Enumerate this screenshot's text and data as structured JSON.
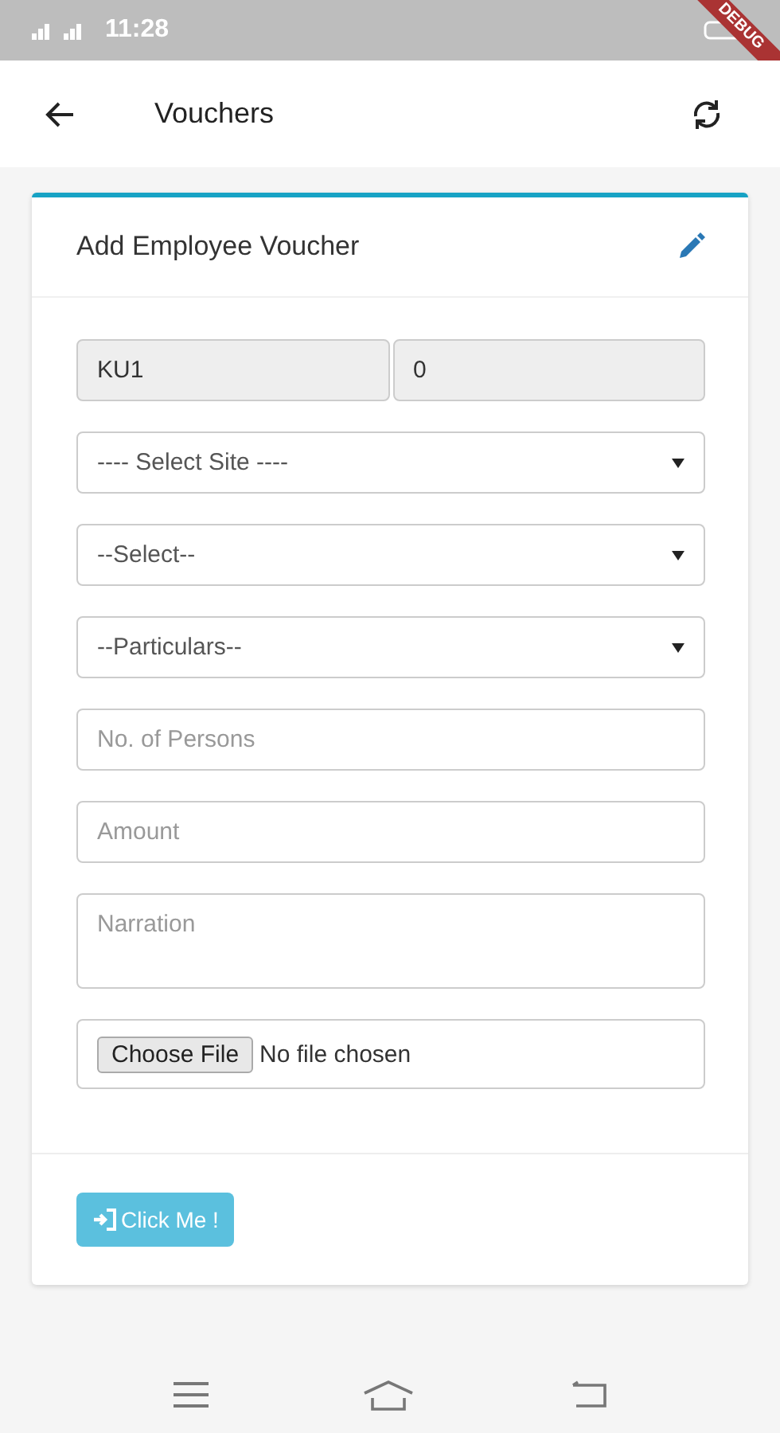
{
  "status_bar": {
    "time": "11:28"
  },
  "debug_banner": "DEBUG",
  "app_bar": {
    "title": "Vouchers"
  },
  "card": {
    "title": "Add Employee Voucher",
    "fields": [
      {
        "kind": "readonly_pair",
        "values": [
          "KU1",
          "0"
        ]
      },
      {
        "kind": "select",
        "value": "---- Select Site ----"
      },
      {
        "kind": "select",
        "value": "--Select--"
      },
      {
        "kind": "select",
        "value": "--Particulars--"
      },
      {
        "kind": "input",
        "placeholder": "No. of Persons"
      },
      {
        "kind": "input",
        "placeholder": "Amount"
      },
      {
        "kind": "textarea",
        "placeholder": "Narration"
      },
      {
        "kind": "file",
        "button": "Choose File",
        "status": "No file chosen"
      }
    ],
    "submit": "Click Me !"
  }
}
